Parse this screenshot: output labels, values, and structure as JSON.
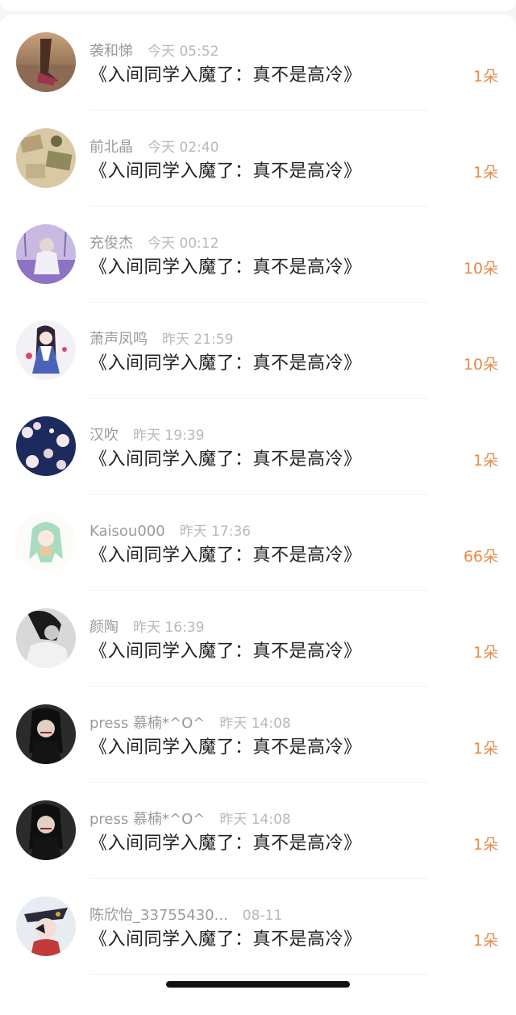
{
  "gifts": [
    {
      "name": "袭和悌",
      "time": "今天 05:52",
      "title": "《入间同学入魔了：真不是高冷》",
      "count": "1朵",
      "avatar": "avatar-feet-road"
    },
    {
      "name": "前北晶",
      "time": "今天 02:40",
      "title": "《入间同学入魔了：真不是高冷》",
      "count": "1朵",
      "avatar": "avatar-paper-texture"
    },
    {
      "name": "充俊杰",
      "time": "今天 00:12",
      "title": "《入间同学入魔了：真不是高冷》",
      "count": "10朵",
      "avatar": "avatar-girl-lavender"
    },
    {
      "name": "萧声凤鸣",
      "time": "昨天 21:59",
      "title": "《入间同学入魔了：真不是高冷》",
      "count": "10朵",
      "avatar": "avatar-anime-girl-blue"
    },
    {
      "name": "汉吹",
      "time": "昨天 19:39",
      "title": "《入间同学入魔了：真不是高冷》",
      "count": "1朵",
      "avatar": "avatar-blossom-night"
    },
    {
      "name": "Kaisou000",
      "time": "昨天 17:36",
      "title": "《入间同学入魔了：真不是高冷》",
      "count": "66朵",
      "avatar": "avatar-green-hair-chibi"
    },
    {
      "name": "颜陶",
      "time": "昨天 16:39",
      "title": "《入间同学入魔了：真不是高冷》",
      "count": "1朵",
      "avatar": "avatar-bw-girl"
    },
    {
      "name": "press 慕楠*^O^",
      "time": "昨天 14:08",
      "title": "《入间同学入魔了：真不是高冷》",
      "count": "1朵",
      "avatar": "avatar-dark-girl"
    },
    {
      "name": "press 慕楠*^O^",
      "time": "昨天 14:08",
      "title": "《入间同学入魔了：真不是高冷》",
      "count": "1朵",
      "avatar": "avatar-dark-girl"
    },
    {
      "name": "陈欣怡_33755430...",
      "time": "08-11",
      "title": "《入间同学入魔了：真不是高冷》",
      "count": "1朵",
      "avatar": "avatar-anime-boy"
    }
  ],
  "colors": {
    "count": "#e98a4a",
    "name": "#9a9a9a",
    "title": "#222222"
  }
}
